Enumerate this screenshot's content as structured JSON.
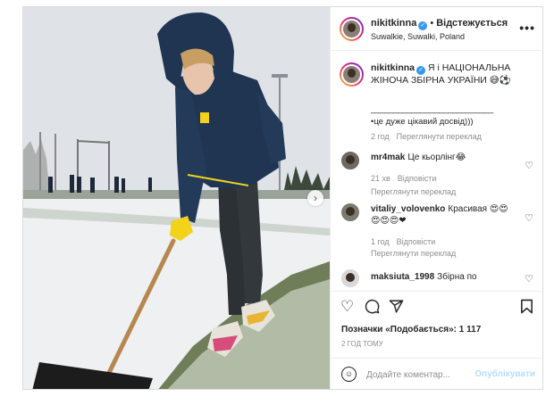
{
  "header": {
    "username": "nikitkinna",
    "verified_icon": "verified-badge-icon",
    "separator": "•",
    "follow_status": "Відстежується",
    "location": "Suwalkie, Suwalki, Poland",
    "more_label": "•••"
  },
  "caption": {
    "username": "nikitkinna",
    "text": "Я і НАЦІОНАЛЬНА ЖІНОЧА ЗБІРНА УКРАЇНИ 😅⚽",
    "rule": "___________________________",
    "extra": "•це дуже цікавий досвід)))",
    "time": "2 год",
    "translate": "Переглянути переклад"
  },
  "comments": [
    {
      "username": "mr4mak",
      "text": "Це кьорлінг😂",
      "time": "21 хв",
      "reply": "Відповісти",
      "translate": "Переглянути переклад"
    },
    {
      "username": "vitaliy_volovenko",
      "text": "Красивая 😍😍 😍😍😍❤",
      "time": "1 год",
      "reply": "Відповісти",
      "translate": "Переглянути переклад"
    },
    {
      "username": "maksiuta_1998",
      "text": "Збірна по"
    }
  ],
  "actions": {
    "like_icon": "heart-icon",
    "comment_icon": "comment-icon",
    "share_icon": "share-icon",
    "save_icon": "bookmark-icon"
  },
  "likes_text": "Позначки «Подобається»: 1 117",
  "post_time": "2 ГОД ТОМУ",
  "add_comment": {
    "placeholder": "Додайте коментар...",
    "publish": "Опублікувати"
  },
  "colors": {
    "accent": "#3897f0",
    "publish_disabled": "#b2dffc",
    "jacket": "#1f3552",
    "glove": "#f2d21b"
  }
}
